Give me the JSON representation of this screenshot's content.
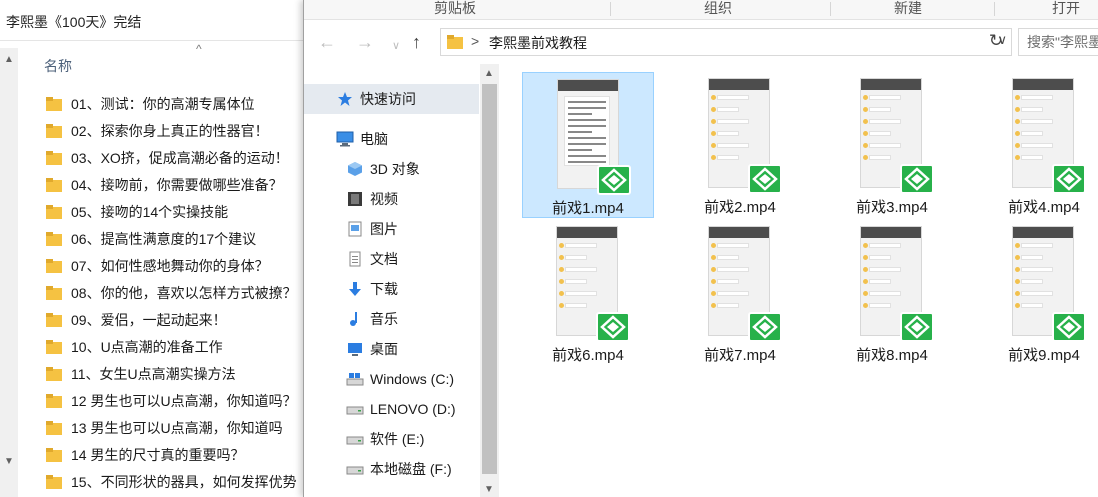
{
  "left_window": {
    "title": "李熙墨《100天》完结",
    "column_header": "名称",
    "sort_indicator": "^",
    "items": [
      {
        "label": "01、测试：你的高潮专属体位"
      },
      {
        "label": "02、探索你身上真正的性器官！"
      },
      {
        "label": "03、XO挤，促成高潮必备的运动！"
      },
      {
        "label": "04、接吻前，你需要做哪些准备？"
      },
      {
        "label": "05、接吻的14个实操技能"
      },
      {
        "label": "06、提高性满意度的17个建议"
      },
      {
        "label": "07、如何性感地舞动你的身体？"
      },
      {
        "label": "08、你的他，喜欢以怎样方式被撩？"
      },
      {
        "label": "09、爱侣，一起动起来！"
      },
      {
        "label": "10、U点高潮的准备工作"
      },
      {
        "label": "11、女生U点高潮实操方法"
      },
      {
        "label": "12 男生也可以U点高潮，你知道吗？"
      },
      {
        "label": "13 男生也可以U点高潮，你知道吗"
      },
      {
        "label": "14 男生的尺寸真的重要吗？"
      },
      {
        "label": "15、不同形状的器具，如何发挥优势"
      }
    ]
  },
  "ribbon": {
    "groups": [
      "剪贴板",
      "组织",
      "新建",
      "打开"
    ]
  },
  "navigation": {
    "back_icon": "arrow-left-icon",
    "forward_icon": "arrow-right-icon",
    "recent_icon": "chevron-down-icon",
    "up_icon": "arrow-up-icon",
    "address_chevron": ">",
    "address_path": "李熙墨前戏教程",
    "search_placeholder": "搜索\"李熙墨"
  },
  "nav_pane": {
    "quick_access": "快速访问",
    "this_pc": "电脑",
    "items": [
      {
        "label": "3D 对象",
        "icon": "3d-objects-icon"
      },
      {
        "label": "视频",
        "icon": "videos-icon"
      },
      {
        "label": "图片",
        "icon": "pictures-icon"
      },
      {
        "label": "文档",
        "icon": "documents-icon"
      },
      {
        "label": "下载",
        "icon": "downloads-icon"
      },
      {
        "label": "音乐",
        "icon": "music-icon"
      },
      {
        "label": "桌面",
        "icon": "desktop-icon"
      },
      {
        "label": "Windows (C:)",
        "icon": "drive-c-icon"
      },
      {
        "label": "LENOVO (D:)",
        "icon": "drive-icon"
      },
      {
        "label": "软件 (E:)",
        "icon": "drive-icon"
      },
      {
        "label": "本地磁盘 (F:)",
        "icon": "drive-icon"
      }
    ]
  },
  "files": [
    {
      "name": "前戏1.mp4",
      "selected": true,
      "style": "text"
    },
    {
      "name": "前戏2.mp4",
      "selected": false,
      "style": "chat"
    },
    {
      "name": "前戏3.mp4",
      "selected": false,
      "style": "chat"
    },
    {
      "name": "前戏4.mp4",
      "selected": false,
      "style": "chat"
    },
    {
      "name": "前戏6.mp4",
      "selected": false,
      "style": "chat"
    },
    {
      "name": "前戏7.mp4",
      "selected": false,
      "style": "chat"
    },
    {
      "name": "前戏8.mp4",
      "selected": false,
      "style": "chat"
    },
    {
      "name": "前戏9.mp4",
      "selected": false,
      "style": "chat"
    }
  ],
  "colors": {
    "selection_bg": "#cce8ff",
    "folder_yellow": "#f5c242",
    "badge_green": "#27b14a",
    "quick_access_bg": "#e5eaf0"
  }
}
